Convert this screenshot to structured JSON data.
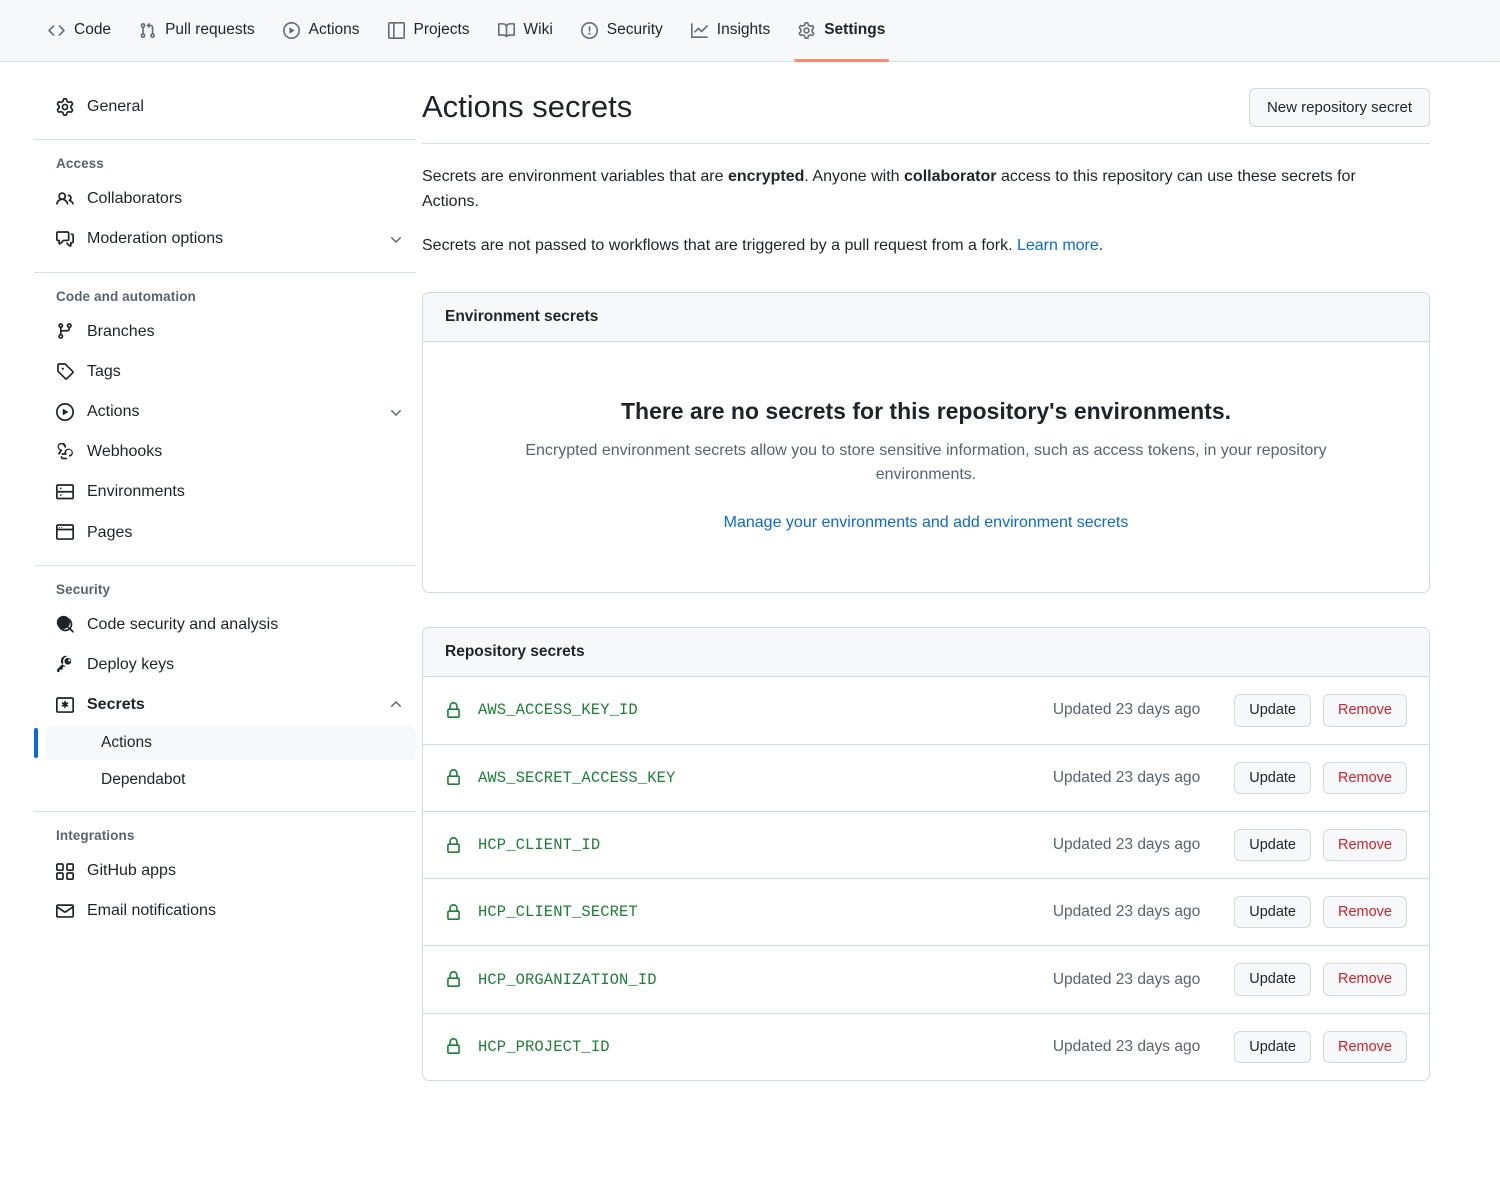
{
  "top_nav": {
    "items": [
      {
        "label": "Code",
        "icon": "code-icon",
        "active": false
      },
      {
        "label": "Pull requests",
        "icon": "git-pull-request-icon",
        "active": false
      },
      {
        "label": "Actions",
        "icon": "play-circle-icon",
        "active": false
      },
      {
        "label": "Projects",
        "icon": "table-icon",
        "active": false
      },
      {
        "label": "Wiki",
        "icon": "book-icon",
        "active": false
      },
      {
        "label": "Security",
        "icon": "shield-alert-icon",
        "active": false
      },
      {
        "label": "Insights",
        "icon": "graph-icon",
        "active": false
      },
      {
        "label": "Settings",
        "icon": "gear-icon",
        "active": true
      }
    ]
  },
  "sidebar": {
    "general": {
      "label": "General",
      "icon": "gear-icon"
    },
    "sections": [
      {
        "heading": "Access",
        "items": [
          {
            "label": "Collaborators",
            "icon": "people-icon",
            "chevron": ""
          },
          {
            "label": "Moderation options",
            "icon": "comment-discussion-icon",
            "chevron": "down"
          }
        ]
      },
      {
        "heading": "Code and automation",
        "items": [
          {
            "label": "Branches",
            "icon": "git-branch-icon",
            "chevron": ""
          },
          {
            "label": "Tags",
            "icon": "tag-icon",
            "chevron": ""
          },
          {
            "label": "Actions",
            "icon": "play-circle-icon",
            "chevron": "down"
          },
          {
            "label": "Webhooks",
            "icon": "webhook-icon",
            "chevron": ""
          },
          {
            "label": "Environments",
            "icon": "server-icon",
            "chevron": ""
          },
          {
            "label": "Pages",
            "icon": "browser-icon",
            "chevron": ""
          }
        ]
      },
      {
        "heading": "Security",
        "items": [
          {
            "label": "Code security and analysis",
            "icon": "code-search-icon",
            "chevron": ""
          },
          {
            "label": "Deploy keys",
            "icon": "key-icon",
            "chevron": ""
          },
          {
            "label": "Secrets",
            "icon": "asterisk-box-icon",
            "chevron": "up",
            "bold": true
          }
        ],
        "subitems": [
          {
            "label": "Actions",
            "selected": true
          },
          {
            "label": "Dependabot",
            "selected": false
          }
        ]
      },
      {
        "heading": "Integrations",
        "items": [
          {
            "label": "GitHub apps",
            "icon": "apps-grid-icon",
            "chevron": ""
          },
          {
            "label": "Email notifications",
            "icon": "mail-icon",
            "chevron": ""
          }
        ]
      }
    ]
  },
  "main": {
    "title": "Actions secrets",
    "new_secret_button": "New repository secret",
    "intro_1": {
      "part_1": "Secrets are environment variables that are ",
      "bold_1": "encrypted",
      "part_2": ". Anyone with ",
      "bold_2": "collaborator",
      "part_3": " access to this repository can use these secrets for Actions."
    },
    "intro_2": {
      "text": "Secrets are not passed to workflows that are triggered by a pull request from a fork. ",
      "link": "Learn more",
      "period": "."
    },
    "environment_card": {
      "header": "Environment secrets",
      "empty_title": "There are no secrets for this repository's environments.",
      "empty_desc": "Encrypted environment secrets allow you to store sensitive information, such as access tokens, in your repository environments.",
      "empty_link": "Manage your environments and add environment secrets"
    },
    "repository_card": {
      "header": "Repository secrets",
      "update_label": "Update",
      "remove_label": "Remove",
      "secrets": [
        {
          "name": "AWS_ACCESS_KEY_ID",
          "updated": "Updated 23 days ago"
        },
        {
          "name": "AWS_SECRET_ACCESS_KEY",
          "updated": "Updated 23 days ago"
        },
        {
          "name": "HCP_CLIENT_ID",
          "updated": "Updated 23 days ago"
        },
        {
          "name": "HCP_CLIENT_SECRET",
          "updated": "Updated 23 days ago"
        },
        {
          "name": "HCP_ORGANIZATION_ID",
          "updated": "Updated 23 days ago"
        },
        {
          "name": "HCP_PROJECT_ID",
          "updated": "Updated 23 days ago"
        }
      ]
    }
  },
  "colors": {
    "accent_blue": "#0969da",
    "secret_green": "#1a7f37",
    "danger_red": "#cf222e",
    "active_tab_underline": "#fd8c73",
    "surface_gray": "#f6f8fa",
    "border": "#d1d9e0",
    "muted_text": "#59636e"
  }
}
